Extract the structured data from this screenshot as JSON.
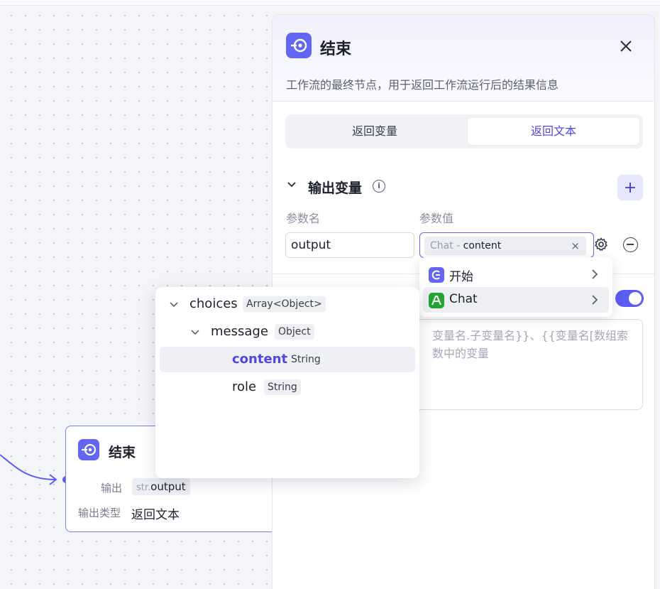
{
  "canvas_node": {
    "title": "结束",
    "output_label": "输出",
    "output_type_tag": "str.",
    "output_value": "output",
    "output_kind_label": "输出类型",
    "output_kind_value": "返回文本"
  },
  "panel": {
    "title": "结束",
    "description": "工作流的最终节点，用于返回工作流运行后的结果信息",
    "tabs": [
      {
        "label": "返回变量",
        "active": false
      },
      {
        "label": "返回文本",
        "active": true
      }
    ],
    "section_title": "输出变量",
    "columns": {
      "name": "参数名",
      "value": "参数值"
    },
    "row": {
      "name_value": "output",
      "ref_source": "Chat",
      "ref_sep": " - ",
      "ref_key": "content",
      "clear_icon": "×"
    },
    "toggle_on": true,
    "textarea_placeholder_line1": "变量名.子变量名}}、{{变量名[数组索",
    "textarea_placeholder_line2": "数中的变量"
  },
  "node_picker": {
    "items": [
      {
        "label": "开始",
        "icon": "start-node-icon",
        "color": "#6366f1"
      },
      {
        "label": "Chat",
        "icon": "chat-node-icon",
        "color": "#22a534"
      }
    ]
  },
  "variable_tree": {
    "rows": [
      {
        "name": "choices",
        "type": "Array<Object>",
        "depth": 0,
        "expandable": true
      },
      {
        "name": "message",
        "type": "Object",
        "depth": 1,
        "expandable": true
      },
      {
        "name": "content",
        "type": "String",
        "depth": 2,
        "expandable": false,
        "selected": true
      },
      {
        "name": "role",
        "type": "String",
        "depth": 2,
        "expandable": false
      }
    ]
  },
  "colors": {
    "accent": "#6366f1",
    "chat_green": "#22a534"
  }
}
